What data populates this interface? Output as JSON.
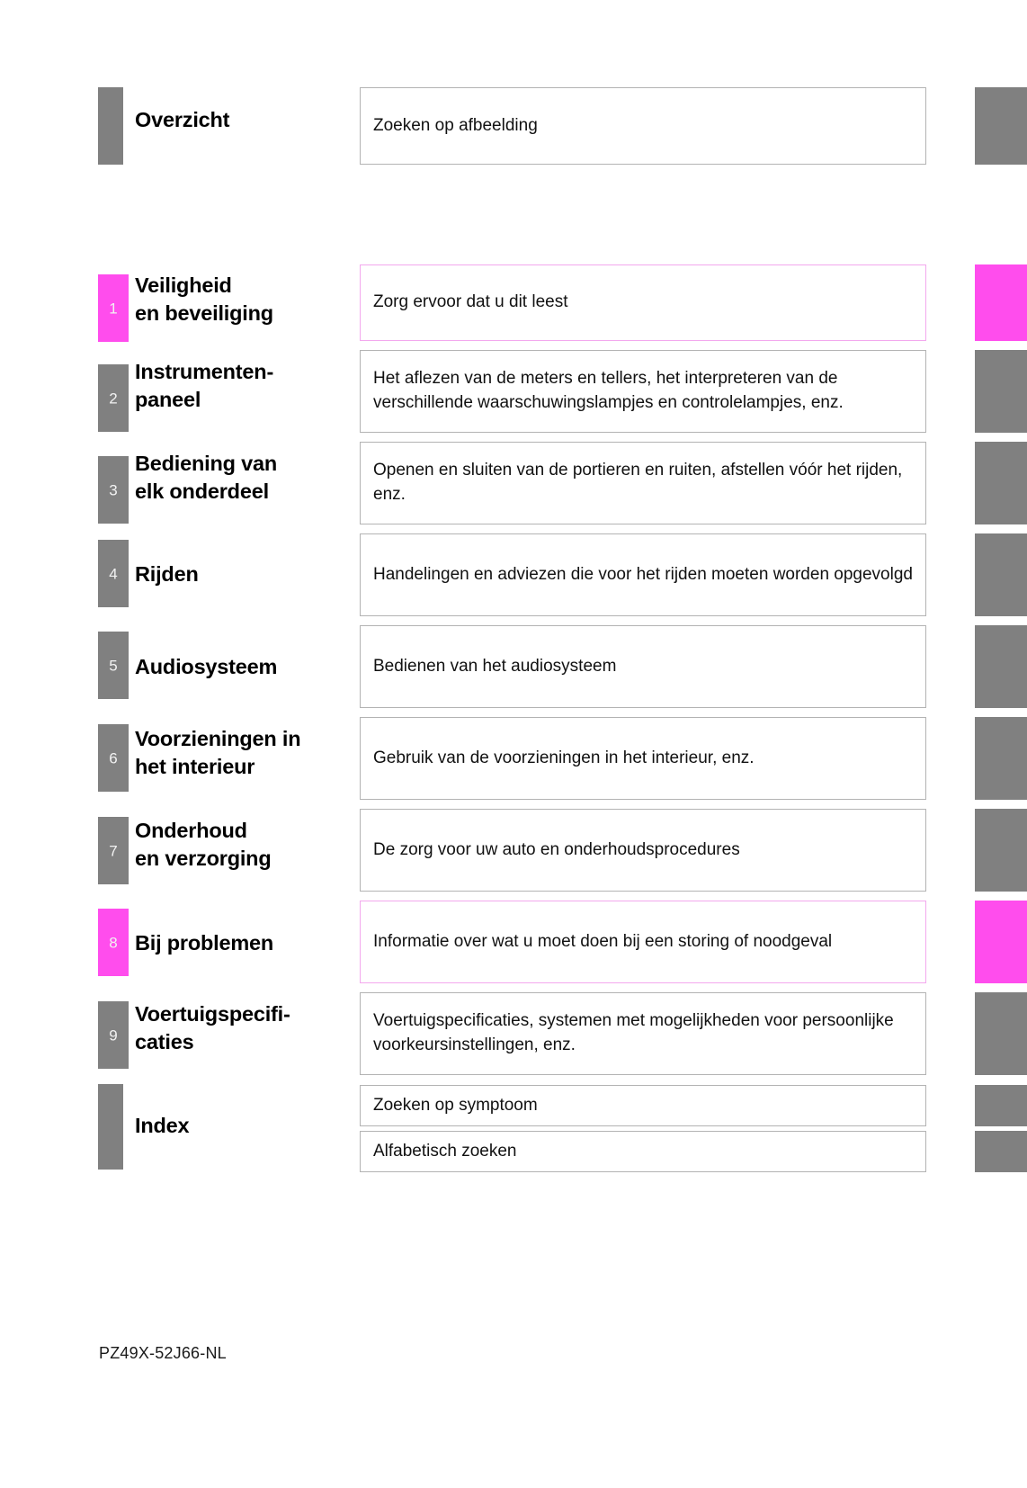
{
  "document": {
    "footer_code": "PZ49X-52J66-NL",
    "accent_color": "#ff4ded",
    "neutral_color": "#808080"
  },
  "sections": [
    {
      "number": "",
      "title": "Overzicht",
      "description": "Zoeken op afbeelding",
      "highlight": false
    },
    {
      "number": "1",
      "title": "Veiligheid\nen beveiliging",
      "description": "Zorg ervoor dat u dit leest",
      "highlight": true
    },
    {
      "number": "2",
      "title": "Instrumenten-\npaneel",
      "description": "Het aflezen van de meters en tellers, het interpreteren van de verschillende waarschuwingslampjes en controlelampjes, enz.",
      "highlight": false
    },
    {
      "number": "3",
      "title": "Bediening van\nelk onderdeel",
      "description": "Openen en sluiten van de portieren en ruiten, afstellen vóór het rijden, enz.",
      "highlight": false
    },
    {
      "number": "4",
      "title": "Rijden",
      "description": "Handelingen en adviezen die voor het rijden moeten worden opgevolgd",
      "highlight": false
    },
    {
      "number": "5",
      "title": "Audiosysteem",
      "description": "Bedienen van het audiosysteem",
      "highlight": false
    },
    {
      "number": "6",
      "title": "Voorzieningen in\nhet interieur",
      "description": "Gebruik van de voorzieningen in het interieur, enz.",
      "highlight": false
    },
    {
      "number": "7",
      "title": "Onderhoud\nen verzorging",
      "description": "De zorg voor uw auto en onderhoudsprocedures",
      "highlight": false
    },
    {
      "number": "8",
      "title": "Bij problemen",
      "description": "Informatie over wat u moet doen bij een storing of noodgeval",
      "highlight": true
    },
    {
      "number": "9",
      "title": "Voertuigspecifi-\ncaties",
      "description": "Voertuigspecificaties, systemen met mogelijkheden voor persoonlijke voorkeursinstellingen, enz.",
      "highlight": false
    }
  ],
  "index": {
    "title": "Index",
    "entries": [
      {
        "description": "Zoeken op symptoom"
      },
      {
        "description": "Alfabetisch zoeken"
      }
    ]
  }
}
